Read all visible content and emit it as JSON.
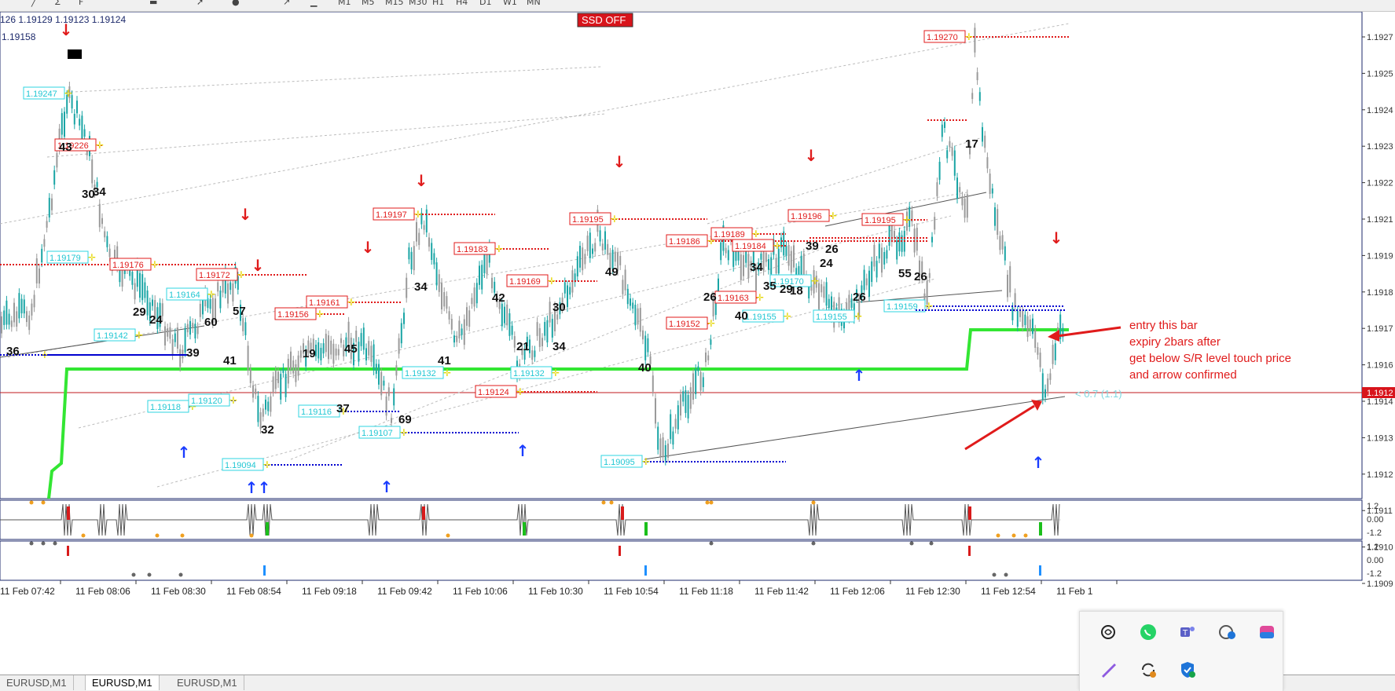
{
  "toolbar": {
    "timeframes": [
      "M1",
      "M5",
      "M15",
      "M30",
      "H1",
      "H4",
      "D1",
      "W1",
      "MN"
    ],
    "icons": [
      "line-tool-icon",
      "fibonacci-tool-icon",
      "text-tool-icon",
      "rectangle-icon",
      "arrow-tool-icon",
      "circle-icon",
      "trend-icon",
      "pen-icon"
    ]
  },
  "chart": {
    "quote_line": "126 1.19129 1.19123 1.19124",
    "bid_line": "1.19158",
    "badge": "SSD OFF",
    "price_axis": [
      {
        "label": "1.1927",
        "price": 1.1927
      },
      {
        "label": "1.1925",
        "price": 1.1925
      },
      {
        "label": "1.1924",
        "price": 1.1924
      },
      {
        "label": "1.1923",
        "price": 1.1923
      },
      {
        "label": "1.1922",
        "price": 1.1922
      },
      {
        "label": "1.1921",
        "price": 1.1921
      },
      {
        "label": "1.1919",
        "price": 1.1919
      },
      {
        "label": "1.1918",
        "price": 1.1918
      },
      {
        "label": "1.1917",
        "price": 1.1917
      },
      {
        "label": "1.1916",
        "price": 1.1916
      },
      {
        "label": "1.1914",
        "price": 1.1914
      },
      {
        "label": "1.1913",
        "price": 1.1913
      },
      {
        "label": "1.1912",
        "price": 1.1912
      },
      {
        "label": "1.1911",
        "price": 1.1911
      },
      {
        "label": "1.1910",
        "price": 1.191
      },
      {
        "label": "1.1909",
        "price": 1.1909
      }
    ],
    "current_price_tag": "1.1912",
    "time_axis": [
      "11 Feb 07:42",
      "11 Feb 08:06",
      "11 Feb 08:30",
      "11 Feb 08:54",
      "11 Feb 09:18",
      "11 Feb 09:42",
      "11 Feb 10:06",
      "11 Feb 10:30",
      "11 Feb 10:54",
      "11 Feb 11:18",
      "11 Feb 11:42",
      "11 Feb 12:06",
      "11 Feb 12:30",
      "11 Feb 12:54",
      "11 Feb 1"
    ],
    "red_levels": [
      "1.19226",
      "1.19176",
      "1.19172",
      "1.19161",
      "1.19156",
      "1.19197",
      "1.19183",
      "1.19169",
      "1.19124",
      "1.19195",
      "1.19186",
      "1.19189",
      "1.19184",
      "1.19163",
      "1.19152",
      "1.19196",
      "1.19195",
      "1.19270"
    ],
    "cyan_levels": [
      "1.19247",
      "1.19179",
      "1.19164",
      "1.19142",
      "1.19118",
      "1.19120",
      "1.19094",
      "1.19116",
      "1.19107",
      "1.19132",
      "1.19132",
      "1.19095",
      "1.19155",
      "1.19170",
      "1.19155",
      "1.19159",
      "1.19158"
    ],
    "counts": [
      "36",
      "43",
      "30",
      "34",
      "29",
      "24",
      "60",
      "57",
      "39",
      "41",
      "32",
      "19",
      "45",
      "37",
      "34",
      "69",
      "41",
      "42",
      "21",
      "30",
      "34",
      "49",
      "40",
      "26",
      "40",
      "34",
      "35",
      "29",
      "18",
      "39",
      "24",
      "26",
      "26",
      "55",
      "26",
      "17"
    ],
    "indicator_scales": [
      "1.2",
      "0.00",
      "-1.2"
    ],
    "indicator2_scales": [
      "1.2",
      "0.00",
      "-1.2"
    ],
    "fib_label": "0.7 (1.1)",
    "annotation": {
      "line1": "entry this bar",
      "line2": "expiry 2bars after",
      "line3": "get below S/R level touch price",
      "line4": "and arrow confirmed"
    },
    "colors": {
      "support_line": "#33e633",
      "resistance": "#e01b1b",
      "support": "#0000d0",
      "candle": "#9a9a9a",
      "candle_bull": "#1aa5a5",
      "arrow_up": "#1a3cff",
      "arrow_down": "#e01b1b"
    }
  },
  "tabs": [
    {
      "label": "EURUSD,M1",
      "active": false
    },
    {
      "label": "EURUSD,M1",
      "active": true
    },
    {
      "label": "EURUSD,M1",
      "active": false
    }
  ],
  "tray": {
    "icons": [
      "chatgpt-icon",
      "whatsapp-icon",
      "teams-icon",
      "phone-link-icon",
      "copilot-icon",
      "pen-app-icon",
      "sync-icon",
      "defender-icon"
    ]
  }
}
